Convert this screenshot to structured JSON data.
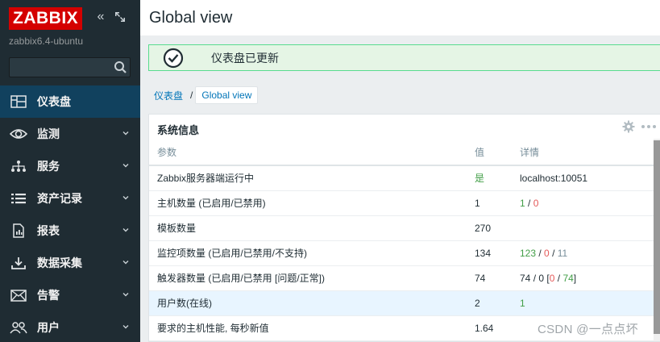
{
  "sidebar": {
    "logo": "ZABBIX",
    "server_name": "zabbix6.4-ubuntu",
    "search_value": "",
    "items": [
      {
        "label": "仪表盘",
        "icon": "dashboard-icon"
      },
      {
        "label": "监测",
        "icon": "eye-icon"
      },
      {
        "label": "服务",
        "icon": "services-icon"
      },
      {
        "label": "资产记录",
        "icon": "list-icon"
      },
      {
        "label": "报表",
        "icon": "report-icon"
      },
      {
        "label": "数据采集",
        "icon": "download-icon"
      },
      {
        "label": "告警",
        "icon": "mail-icon"
      },
      {
        "label": "用户",
        "icon": "users-icon"
      }
    ]
  },
  "header": {
    "title": "Global view"
  },
  "message": {
    "text": "仪表盘已更新"
  },
  "breadcrumb": {
    "parent": "仪表盘",
    "current": "Global view"
  },
  "widget": {
    "title": "系统信息",
    "columns": [
      "参数",
      "值",
      "详情"
    ],
    "rows": [
      {
        "param": "Zabbix服务器端运行中",
        "value": "是",
        "detail": "localhost:10051"
      },
      {
        "param": "主机数量 (已启用/已禁用)",
        "value": "1",
        "d_a": "1",
        "d_b": "0"
      },
      {
        "param": "模板数量",
        "value": "270",
        "detail": ""
      },
      {
        "param": "监控项数量 (已启用/已禁用/不支持)",
        "value": "134",
        "d_a": "123",
        "d_b": "0",
        "d_c": "11"
      },
      {
        "param": "触发器数量 (已启用/已禁用 [问题/正常])",
        "value": "74",
        "d_a": "74",
        "d_b": "0",
        "d_c": "0",
        "d_d": "74"
      },
      {
        "param": "用户数(在线)",
        "value": "2",
        "detail": "1"
      },
      {
        "param": "要求的主机性能, 每秒新值",
        "value": "1.64",
        "detail": ""
      }
    ]
  },
  "watermark": "CSDN @一点点坏",
  "colors": {
    "sidebar_bg": "#1f2c33",
    "active_bg": "#11415e",
    "logo_red": "#d40000",
    "success_bg": "#e5f5e5",
    "success_border": "#59db8f",
    "link_blue": "#0275b8",
    "green": "#429e47",
    "red": "#e45959"
  }
}
